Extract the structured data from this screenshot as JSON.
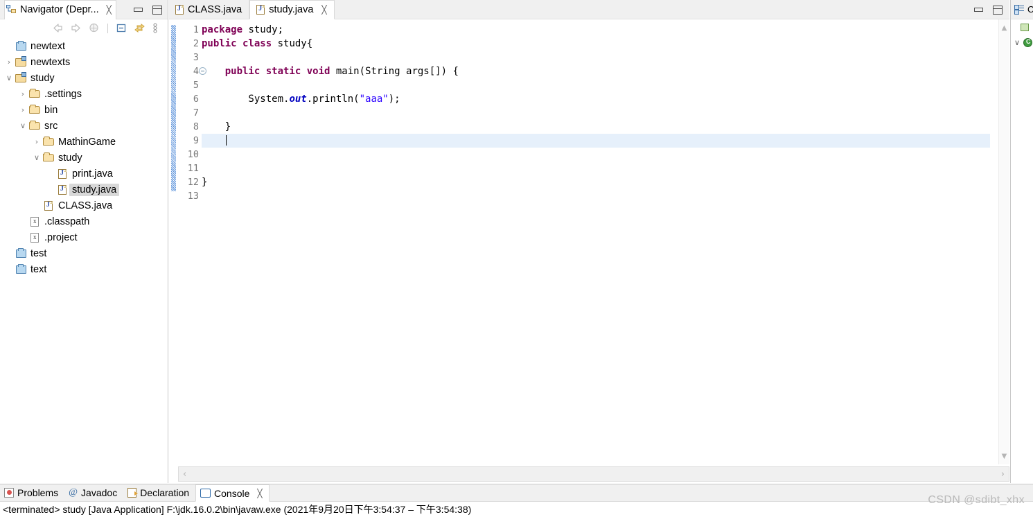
{
  "navigator": {
    "tab_title": "Navigator (Depr...",
    "close_label": "╳",
    "toolbar": {
      "back": "back-arrow",
      "forward": "forward-arrow",
      "home": "home",
      "collapse_all": "collapse-all",
      "link_editor": "link-with-editor",
      "view_menu": "view-menu"
    },
    "tree": [
      {
        "label": "newtext",
        "indent": 1,
        "twisty": "",
        "icon": "project-closed"
      },
      {
        "label": "newtexts",
        "indent": 1,
        "twisty": "›",
        "icon": "project-open-java"
      },
      {
        "label": "study",
        "indent": 1,
        "twisty": "∨",
        "icon": "project-open-java"
      },
      {
        "label": ".settings",
        "indent": 2,
        "twisty": "›",
        "icon": "folder"
      },
      {
        "label": "bin",
        "indent": 2,
        "twisty": "›",
        "icon": "folder"
      },
      {
        "label": "src",
        "indent": 2,
        "twisty": "∨",
        "icon": "folder"
      },
      {
        "label": "MathinGame",
        "indent": 3,
        "twisty": "›",
        "icon": "folder"
      },
      {
        "label": "study",
        "indent": 3,
        "twisty": "∨",
        "icon": "folder"
      },
      {
        "label": "print.java",
        "indent": 4,
        "twisty": "",
        "icon": "java"
      },
      {
        "label": "study.java",
        "indent": 4,
        "twisty": "",
        "icon": "java",
        "selected": true
      },
      {
        "label": "CLASS.java",
        "indent": 3,
        "twisty": "",
        "icon": "java"
      },
      {
        "label": ".classpath",
        "indent": 2,
        "twisty": "",
        "icon": "xml"
      },
      {
        "label": ".project",
        "indent": 2,
        "twisty": "",
        "icon": "xml"
      },
      {
        "label": "test",
        "indent": 1,
        "twisty": "",
        "icon": "project-closed"
      },
      {
        "label": "text",
        "indent": 1,
        "twisty": "",
        "icon": "project-closed"
      }
    ]
  },
  "editor": {
    "tabs": [
      {
        "label": "CLASS.java",
        "active": false,
        "closable": false
      },
      {
        "label": "study.java",
        "active": true,
        "closable": true
      }
    ],
    "close_label": "╳",
    "line_numbers": [
      "1",
      "2",
      "3",
      "4",
      "5",
      "6",
      "7",
      "8",
      "9",
      "10",
      "11",
      "12",
      "13"
    ],
    "fold_line": 4,
    "highlight_line": 9,
    "code_lines": [
      {
        "n": 1,
        "tokens": [
          {
            "t": "package",
            "c": "kw"
          },
          {
            "t": " study;",
            "c": "pln"
          }
        ]
      },
      {
        "n": 2,
        "tokens": [
          {
            "t": "public class",
            "c": "kw"
          },
          {
            "t": " study{",
            "c": "pln"
          }
        ]
      },
      {
        "n": 3,
        "tokens": []
      },
      {
        "n": 4,
        "tokens": [
          {
            "t": "    ",
            "c": "pln"
          },
          {
            "t": "public static void",
            "c": "kw"
          },
          {
            "t": " main(String args[]) {",
            "c": "pln"
          }
        ]
      },
      {
        "n": 5,
        "tokens": []
      },
      {
        "n": 6,
        "tokens": [
          {
            "t": "        System.",
            "c": "pln"
          },
          {
            "t": "out",
            "c": "fld"
          },
          {
            "t": ".println(",
            "c": "pln"
          },
          {
            "t": "\"aaa\"",
            "c": "str"
          },
          {
            "t": ");",
            "c": "pln"
          }
        ]
      },
      {
        "n": 7,
        "tokens": []
      },
      {
        "n": 8,
        "tokens": [
          {
            "t": "    }",
            "c": "pln"
          }
        ]
      },
      {
        "n": 9,
        "tokens": [
          {
            "t": "    ",
            "c": "pln"
          }
        ],
        "caret": true
      },
      {
        "n": 10,
        "tokens": []
      },
      {
        "n": 11,
        "tokens": []
      },
      {
        "n": 12,
        "tokens": [
          {
            "t": "}",
            "c": "pln"
          }
        ]
      },
      {
        "n": 13,
        "tokens": []
      }
    ],
    "scroll": {
      "up_arrow": "▲",
      "down_arrow": "▼",
      "left_arrow": "‹",
      "right_arrow": "›"
    }
  },
  "outline": {
    "tab_label": "O",
    "items": [
      {
        "label": "",
        "icon": "package",
        "twisty": ""
      },
      {
        "label": "",
        "icon": "class",
        "twisty": "∨"
      }
    ]
  },
  "bottom": {
    "tabs": [
      {
        "label": "Problems",
        "icon": "problems-icon",
        "active": false,
        "closable": false
      },
      {
        "label": "Javadoc",
        "icon": "javadoc-icon",
        "active": false,
        "closable": false
      },
      {
        "label": "Declaration",
        "icon": "declaration-icon",
        "active": false,
        "closable": false
      },
      {
        "label": "Console",
        "icon": "console-icon",
        "active": true,
        "closable": true
      }
    ],
    "close_label": "╳",
    "console_text": "<terminated> study [Java Application] F:\\jdk.16.0.2\\bin\\javaw.exe  (2021年9月20日下午3:54:37 – 下午3:54:38)"
  },
  "watermark": "CSDN @sdibt_xhx",
  "colors": {
    "keyword": "#7f0055",
    "string": "#2a00ff",
    "field": "#0000c0",
    "line_highlight": "#e6f0fb",
    "tab_active_bg": "#ffffff",
    "chrome_bg": "#f0f0f0",
    "selection": "#d8d8d8"
  }
}
